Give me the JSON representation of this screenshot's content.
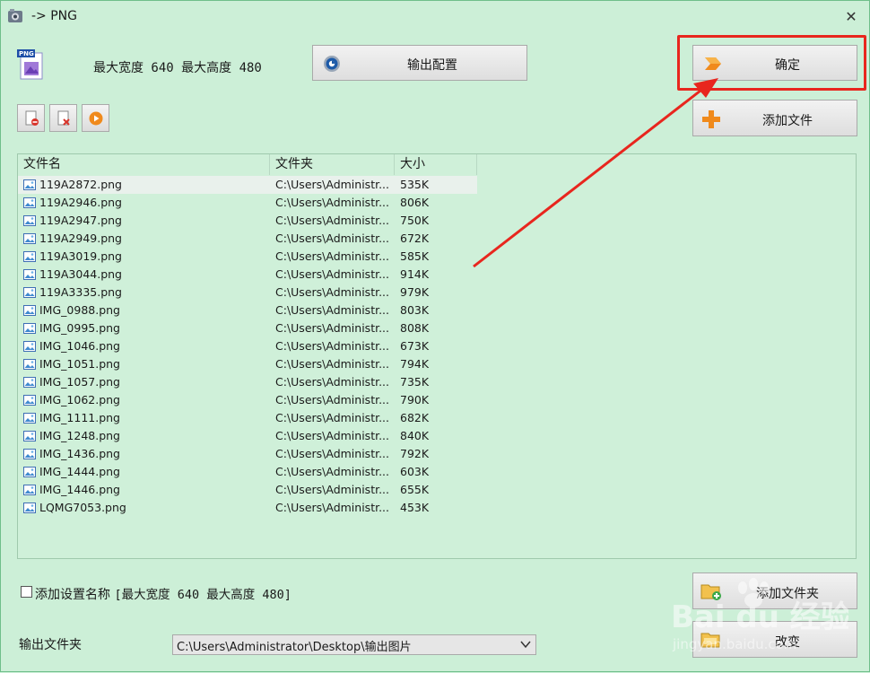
{
  "window": {
    "title": "-> PNG"
  },
  "summary": "最大宽度 640 最大高度 480",
  "buttons": {
    "config": "输出配置",
    "ok": "确定",
    "add_file": "添加文件",
    "add_folder": "添加文件夹",
    "change": "改变"
  },
  "list": {
    "headers": [
      "文件名",
      "文件夹",
      "大小"
    ],
    "rows": [
      {
        "name": "119A2872.png",
        "folder": "C:\\Users\\Administr...",
        "size": "535K"
      },
      {
        "name": "119A2946.png",
        "folder": "C:\\Users\\Administr...",
        "size": "806K"
      },
      {
        "name": "119A2947.png",
        "folder": "C:\\Users\\Administr...",
        "size": "750K"
      },
      {
        "name": "119A2949.png",
        "folder": "C:\\Users\\Administr...",
        "size": "672K"
      },
      {
        "name": "119A3019.png",
        "folder": "C:\\Users\\Administr...",
        "size": "585K"
      },
      {
        "name": "119A3044.png",
        "folder": "C:\\Users\\Administr...",
        "size": "914K"
      },
      {
        "name": "119A3335.png",
        "folder": "C:\\Users\\Administr...",
        "size": "979K"
      },
      {
        "name": "IMG_0988.png",
        "folder": "C:\\Users\\Administr...",
        "size": "803K"
      },
      {
        "name": "IMG_0995.png",
        "folder": "C:\\Users\\Administr...",
        "size": "808K"
      },
      {
        "name": "IMG_1046.png",
        "folder": "C:\\Users\\Administr...",
        "size": "673K"
      },
      {
        "name": "IMG_1051.png",
        "folder": "C:\\Users\\Administr...",
        "size": "794K"
      },
      {
        "name": "IMG_1057.png",
        "folder": "C:\\Users\\Administr...",
        "size": "735K"
      },
      {
        "name": "IMG_1062.png",
        "folder": "C:\\Users\\Administr...",
        "size": "790K"
      },
      {
        "name": "IMG_1111.png",
        "folder": "C:\\Users\\Administr...",
        "size": "682K"
      },
      {
        "name": "IMG_1248.png",
        "folder": "C:\\Users\\Administr...",
        "size": "840K"
      },
      {
        "name": "IMG_1436.png",
        "folder": "C:\\Users\\Administr...",
        "size": "792K"
      },
      {
        "name": "IMG_1444.png",
        "folder": "C:\\Users\\Administr...",
        "size": "603K"
      },
      {
        "name": "IMG_1446.png",
        "folder": "C:\\Users\\Administr...",
        "size": "655K"
      },
      {
        "name": "LQMG7053.png",
        "folder": "C:\\Users\\Administr...",
        "size": "453K"
      }
    ]
  },
  "option": {
    "label": "添加设置名称",
    "value": "[最大宽度 640 最大高度 480]",
    "checked": false
  },
  "output": {
    "label": "输出文件夹",
    "path": "C:\\Users\\Administrator\\Desktop\\输出图片"
  },
  "watermark": {
    "brand": "Bai du 经验",
    "url": "jingyan.baidu.com"
  },
  "colors": {
    "highlight": "#e8261e",
    "background": "#ccefd7"
  }
}
